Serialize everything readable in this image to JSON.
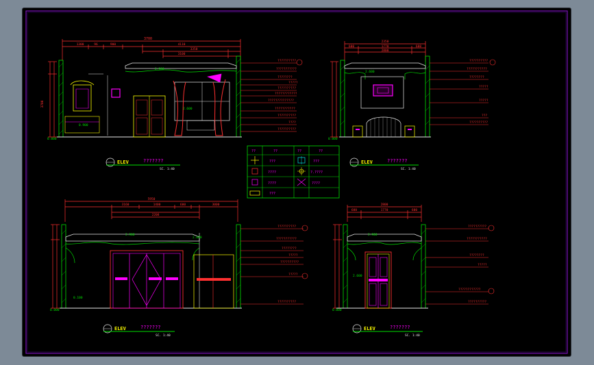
{
  "colors": {
    "background": "#000000",
    "page": "#7d8a97",
    "border": "#7a12b8",
    "dim": "#ff3030",
    "leader": "#ff3030",
    "outline": "#e8e8e8",
    "wall": "#00e000",
    "accent": "#ff00ff",
    "frame": "#ffff00",
    "title": "#ff00ff"
  },
  "views": [
    {
      "title": "ELEV",
      "name": "???????",
      "scale": "SC. 1:40",
      "dims": [
        "3700",
        "1300",
        "96",
        "900",
        "4110",
        "3350",
        "3100"
      ],
      "levels": [
        "2.900",
        "2.600",
        "1.700",
        "0.900",
        "0.000"
      ],
      "notes": [
        "??????????",
        "???????????",
        "????????",
        "?????",
        "??????????",
        "????????????",
        "??????????????",
        "???????????",
        "??????????",
        "????",
        "??????????"
      ]
    },
    {
      "title": "ELEV",
      "name": "???????",
      "scale": "SC. 1:40",
      "dims": [
        "2350",
        "600",
        "1770",
        "600",
        "2800"
      ],
      "levels": [
        "2.600",
        "0.000"
      ],
      "notes": [
        "??????????",
        "???????????",
        "????????",
        "?????",
        "?????",
        "??????????",
        "???",
        "??????????"
      ]
    },
    {
      "title": "ELEV",
      "name": "???????",
      "scale": "SC. 1:40",
      "dims": [
        "5950",
        "3160",
        "1400",
        "600",
        "3000",
        "2208",
        "600",
        "400"
      ],
      "levels": [
        "2.900",
        "2.600",
        "0.100",
        "0.000"
      ],
      "notes": [
        "??????????",
        "???????????",
        "????????",
        "?????",
        "??????????",
        "?????",
        "??????????"
      ]
    },
    {
      "title": "ELEV",
      "name": "???????",
      "scale": "SC. 1:40",
      "dims": [
        "2800",
        "600",
        "1770",
        "600"
      ],
      "levels": [
        "2.900",
        "2.600",
        "0.000"
      ],
      "notes": [
        "??????????",
        "???????????",
        "????????",
        "?????",
        "????????????",
        "??????????"
      ]
    }
  ],
  "legend": {
    "headers": [
      "??",
      "??",
      "??",
      "??"
    ],
    "rows": [
      [
        "???",
        "???"
      ],
      [
        "????",
        "?.????"
      ],
      [
        "????",
        "????"
      ],
      [
        "???",
        ""
      ]
    ]
  }
}
